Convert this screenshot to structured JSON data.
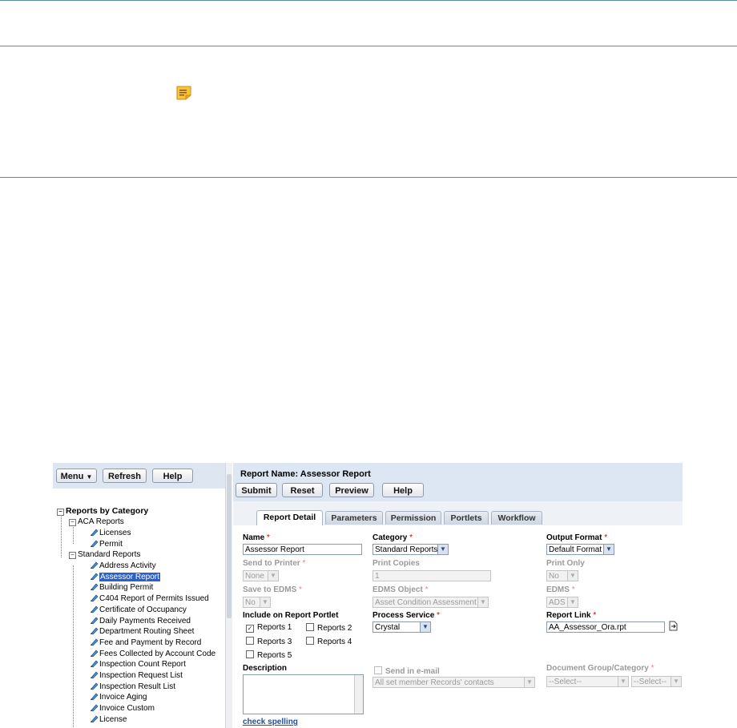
{
  "left_panel": {
    "toolbar": {
      "menu_label": "Menu",
      "refresh_label": "Refresh",
      "help_label": "Help"
    },
    "tree": {
      "root_label": "Reports by Category",
      "groups": [
        {
          "label": "ACA Reports",
          "items": [
            "Licenses",
            "Permit"
          ]
        },
        {
          "label": "Standard Reports",
          "items": [
            "Address Activity",
            "Assessor Report",
            "Building Permit",
            "C404 Report of Permits Issued",
            "Certificate of Occupancy",
            "Daily Payments Received",
            "Department Routing Sheet",
            "Fee and Payment by Record",
            "Fees Collected by Account Code",
            "Inspection Count Report",
            "Inspection Request List",
            "Inspection Result List",
            "Invoice Aging",
            "Invoice Custom",
            "License"
          ]
        }
      ],
      "selected_item": "Assessor Report"
    }
  },
  "right_panel": {
    "title": "Report Name: Assessor Report",
    "toolbar": {
      "submit_label": "Submit",
      "reset_label": "Reset",
      "preview_label": "Preview",
      "help_label": "Help"
    },
    "tabs": [
      {
        "label": "Report Detail",
        "active": true
      },
      {
        "label": "Parameters",
        "active": false
      },
      {
        "label": "Permission",
        "active": false
      },
      {
        "label": "Portlets",
        "active": false
      },
      {
        "label": "Workflow",
        "active": false
      }
    ],
    "form": {
      "name": {
        "label": "Name",
        "value": "Assessor Report"
      },
      "category": {
        "label": "Category",
        "value": "Standard Reports"
      },
      "output_format": {
        "label": "Output Format",
        "value": "Default Format"
      },
      "send_to_printer": {
        "label": "Send to Printer",
        "value": "None"
      },
      "print_copies": {
        "label": "Print Copies",
        "value": "1"
      },
      "print_only": {
        "label": "Print Only",
        "value": "No"
      },
      "save_to_edms": {
        "label": "Save to EDMS",
        "value": "No"
      },
      "edms_object": {
        "label": "EDMS Object",
        "value": "Asset Condition Assessment"
      },
      "edms": {
        "label": "EDMS",
        "value": "ADS"
      },
      "include_on_portlet": {
        "label": "Include on Report Portlet",
        "options": [
          {
            "label": "Reports 1",
            "checked": true
          },
          {
            "label": "Reports 2",
            "checked": false
          },
          {
            "label": "Reports 3",
            "checked": false
          },
          {
            "label": "Reports 4",
            "checked": false
          },
          {
            "label": "Reports 5",
            "checked": false
          }
        ]
      },
      "process_service": {
        "label": "Process Service",
        "value": "Crystal"
      },
      "report_link": {
        "label": "Report Link",
        "value": "AA_Assessor_Ora.rpt"
      },
      "description": {
        "label": "Description",
        "value": ""
      },
      "send_in_email": {
        "label": "Send in e-mail",
        "checked": false,
        "recipients": "All set member Records' contacts"
      },
      "document_group": {
        "label": "Document Group/Category",
        "group_value": "--Select--",
        "category_value": "--Select--"
      },
      "check_spelling": "check spelling",
      "required_marker": "*"
    }
  },
  "colors": {
    "rule_line": "#5b8aa4",
    "header_bg": "#dce7f3",
    "selection": "#2a60c8",
    "required": "#cc0000",
    "note_icon": "#f5b82a"
  },
  "icons": [
    "note-icon",
    "menu-dropdown-icon",
    "pencil-icon",
    "expand-icon",
    "report-link-icon",
    "select-arrow-icon"
  ]
}
